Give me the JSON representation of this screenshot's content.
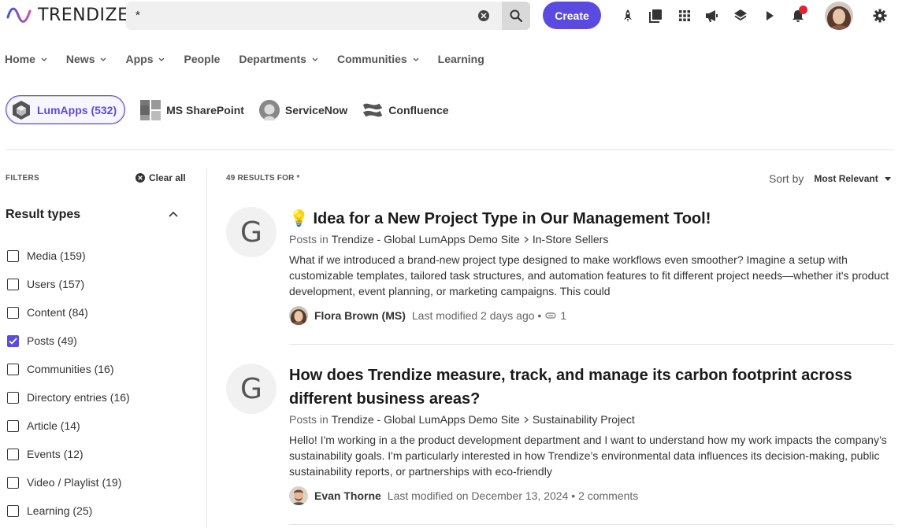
{
  "header": {
    "logo_text": "TRENDIZE",
    "search_value": "*",
    "create_label": "Create",
    "accent": "#5b4ae0",
    "icons": [
      "rocket-icon",
      "library-icon",
      "apps-grid-icon",
      "megaphone-icon",
      "layers-icon",
      "play-icon",
      "bell-icon",
      "avatar",
      "settings-icon"
    ]
  },
  "nav": {
    "items": [
      {
        "label": "Home",
        "dropdown": true
      },
      {
        "label": "News",
        "dropdown": true
      },
      {
        "label": "Apps",
        "dropdown": true
      },
      {
        "label": "People",
        "dropdown": false
      },
      {
        "label": "Departments",
        "dropdown": true
      },
      {
        "label": "Communities",
        "dropdown": true
      },
      {
        "label": "Learning",
        "dropdown": false
      }
    ]
  },
  "sources": [
    {
      "label": "LumApps (532)",
      "active": true
    },
    {
      "label": "MS SharePoint",
      "active": false
    },
    {
      "label": "ServiceNow",
      "active": false
    },
    {
      "label": "Confluence",
      "active": false
    }
  ],
  "filters": {
    "title": "FILTERS",
    "clear_all": "Clear all",
    "result_types_title": "Result types",
    "items": [
      {
        "label": "Media (159)",
        "checked": false
      },
      {
        "label": "Users (157)",
        "checked": false
      },
      {
        "label": "Content (84)",
        "checked": false
      },
      {
        "label": "Posts (49)",
        "checked": true
      },
      {
        "label": "Communities (16)",
        "checked": false
      },
      {
        "label": "Directory entries (16)",
        "checked": false
      },
      {
        "label": "Article (14)",
        "checked": false
      },
      {
        "label": "Events (12)",
        "checked": false
      },
      {
        "label": "Video / Playlist (19)",
        "checked": false
      },
      {
        "label": "Learning (25)",
        "checked": false
      }
    ]
  },
  "results": {
    "count_label": "49 RESULTS FOR *",
    "sort_by_label": "Sort by",
    "sort_value": "Most Relevant",
    "items": [
      {
        "avatar_letter": "G",
        "emoji": "💡",
        "title": "Idea for a New Project Type in Our Management Tool!",
        "posted_in": "Posts in",
        "site": "Trendize - Global LumApps Demo Site",
        "community": "In-Store Sellers",
        "excerpt": "What if we introduced a brand-new project type designed to make workflows even smoother? Imagine a setup with customizable templates, tailored task structures, and automation features to fit different project needs—whether it's product development, event planning, or marketing campaigns. This could",
        "author": "Flora Brown (MS)",
        "modified": "Last modified 2 days ago •",
        "attachments": "1"
      },
      {
        "avatar_letter": "G",
        "emoji": "",
        "title": "How does Trendize measure, track, and manage its carbon footprint across different business areas?",
        "posted_in": "Posts in",
        "site": "Trendize - Global LumApps Demo Site",
        "community": "Sustainability Project",
        "excerpt": "Hello! I'm working in a the product development department and I want to understand how my work impacts the company’s sustainability goals. I'm particularly interested in how Trendize’s environmental data influences its decision-making, public sustainability reports, or partnerships with eco-friendly",
        "author": "Evan Thorne",
        "modified": "Last modified on December 13, 2024 • 2 comments",
        "attachments": ""
      }
    ]
  }
}
